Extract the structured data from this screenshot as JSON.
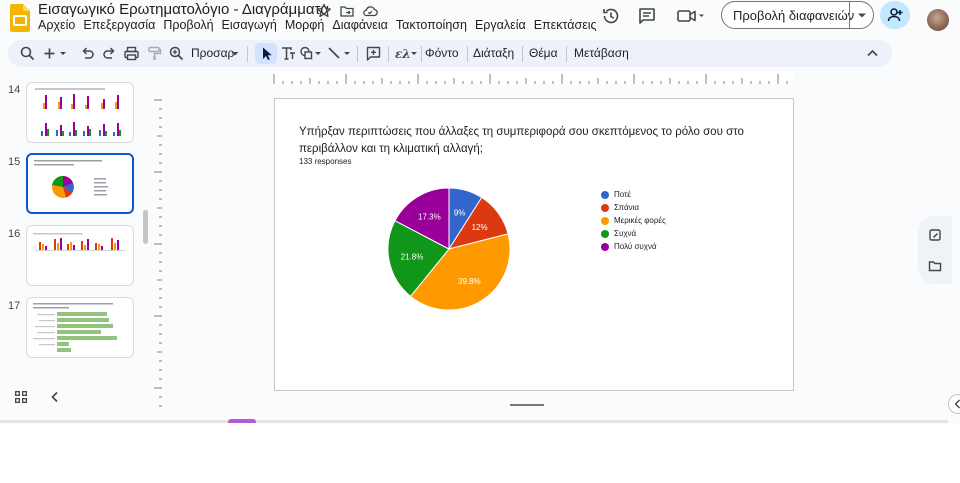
{
  "header": {
    "title": "Εισαγωγικό Ερωτηματολόγιο - Διαγράμματα",
    "menu": [
      "Αρχείο",
      "Επεξεργασία",
      "Προβολή",
      "Εισαγωγή",
      "Μορφή",
      "Διαφάνεια",
      "Τακτοποίηση",
      "Εργαλεία",
      "Επεκτάσεις"
    ],
    "present_label": "Προβολή διαφανειών",
    "title_icons": [
      "star-icon",
      "move-to-folder-icon",
      "cloud-saved-icon"
    ],
    "right_icons": [
      "history-icon",
      "comments-icon",
      "video-call-icon",
      "share-add-person-icon"
    ]
  },
  "toolbar": {
    "zoom_label": "Προσαρ",
    "background_label": "Φόντο",
    "layout_label": "Διάταξη",
    "theme_label": "Θέμα",
    "transition_label": "Μετάβαση"
  },
  "filmstrip": {
    "slides": [
      {
        "number": "14",
        "selected": false
      },
      {
        "number": "15",
        "selected": true
      },
      {
        "number": "16",
        "selected": false
      },
      {
        "number": "17",
        "selected": false
      }
    ]
  },
  "slide": {
    "question": "Υπήρξαν περιπτώσεις που άλλαξες τη συμπεριφορά σου σκεπτόμενος το ρόλο σου στο περιβάλλον και τη κλιματική αλλαγή;",
    "responses": "133 responses"
  },
  "chart_data": {
    "type": "pie",
    "title": "",
    "start_angle_deg": 90,
    "categories": [
      "Ποτέ",
      "Σπάνια",
      "Μερικές φορές",
      "Συχνά",
      "Πολύ συχνά"
    ],
    "values": [
      9,
      12,
      39.8,
      21.8,
      17.3
    ],
    "labels": [
      "9%",
      "12%",
      "39.8%",
      "21.8%",
      "17.3%"
    ],
    "colors": [
      "#3366cc",
      "#dc3912",
      "#ff9900",
      "#109618",
      "#990099"
    ],
    "legend_position": "right"
  }
}
